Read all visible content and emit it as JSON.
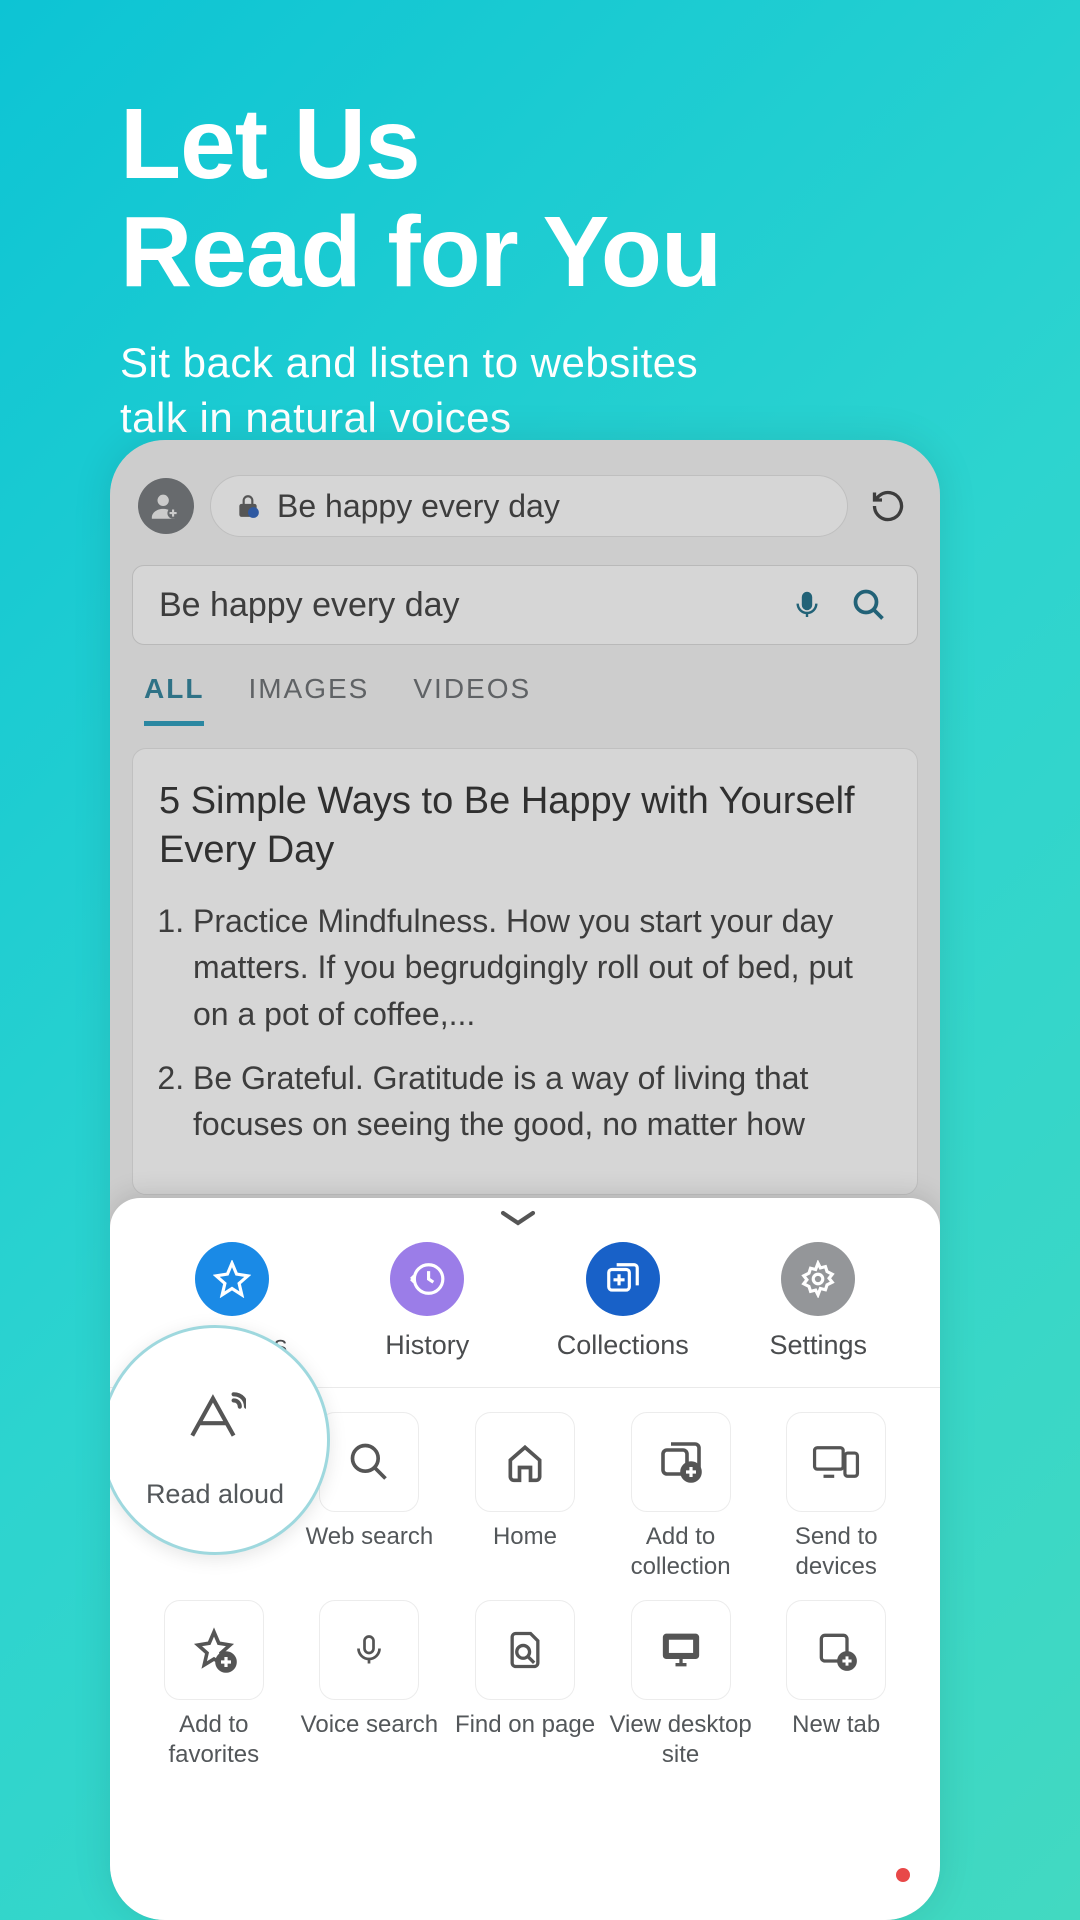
{
  "hero": {
    "title_line1": "Let Us",
    "title_line2": "Read for You",
    "subtitle_line1": "Sit back and listen to websites",
    "subtitle_line2": "talk in natural voices"
  },
  "urlbar": {
    "text": "Be happy every day"
  },
  "searchbox": {
    "text": "Be happy every day"
  },
  "tabs": {
    "all": "ALL",
    "images": "IMAGES",
    "videos": "VIDEOS"
  },
  "result": {
    "title": " 5 Simple Ways to Be Happy with Yourself Every Day",
    "item1": "Practice Mindfulness. How you start your day matters. If you begrudgingly roll out of bed, put on a pot of coffee,...",
    "item2": "Be Grateful. Gratitude is a way of living that focuses on seeing the good, no matter how"
  },
  "sheet_top": {
    "favorites": "Favorites",
    "history": "History",
    "collections": "Collections",
    "settings": "Settings"
  },
  "highlight": {
    "label": "Read aloud"
  },
  "grid": {
    "web_search": "Web search",
    "home": "Home",
    "add_collection": "Add to collection",
    "send_devices": "Send to devices",
    "add_favorites": "Add to favorites",
    "voice_search": "Voice search",
    "find_page": "Find on page",
    "view_desktop": "View desktop site",
    "new_tab": "New tab"
  },
  "colors": {
    "fav": "#1a8ae6",
    "hist": "#9b7de8",
    "coll": "#1861c8",
    "sett": "#949699"
  }
}
